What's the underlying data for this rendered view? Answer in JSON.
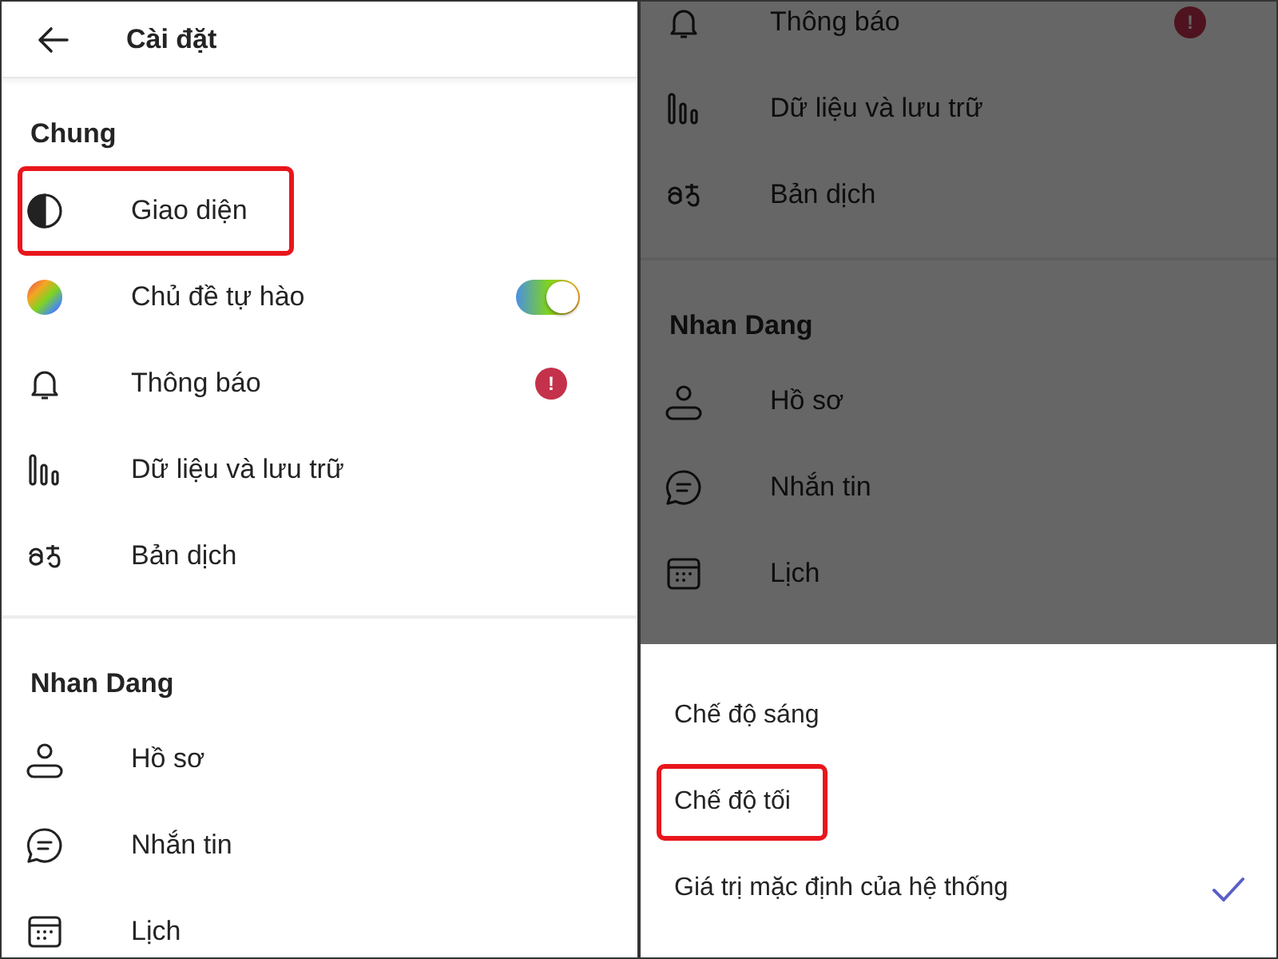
{
  "settings_page": {
    "header": {
      "title": "Cài đặt"
    },
    "sections": [
      {
        "title": "Chung",
        "items": [
          {
            "kind": "contrast",
            "label": "Giao diện",
            "highlighted": true
          },
          {
            "kind": "palette",
            "label": "Chủ đề tự hào",
            "highlighted": false,
            "toggle": {
              "on": true
            }
          },
          {
            "kind": "bell",
            "label": "Thông báo",
            "highlighted": false,
            "badge": "!"
          },
          {
            "kind": "bars",
            "label": "Dữ liệu và lưu trữ",
            "highlighted": false
          },
          {
            "kind": "translate",
            "label": "Bản dịch",
            "highlighted": false
          }
        ]
      },
      {
        "title": "Nhan Dang",
        "items": [
          {
            "kind": "person",
            "label": "Hồ sơ",
            "highlighted": false
          },
          {
            "kind": "chat",
            "label": "Nhắn tin",
            "highlighted": false
          },
          {
            "kind": "calendar",
            "label": "Lịch",
            "highlighted": false
          }
        ]
      }
    ]
  },
  "appearance_page": {
    "sections": [
      {
        "items": [
          {
            "kind": "bell",
            "label": "Thông báo",
            "highlighted": false,
            "badge": "!"
          },
          {
            "kind": "bars",
            "label": "Dữ liệu và lưu trữ",
            "highlighted": false
          },
          {
            "kind": "translate",
            "label": "Bản dịch",
            "highlighted": false
          }
        ]
      },
      {
        "title": "Nhan Dang",
        "items": [
          {
            "kind": "person",
            "label": "Hồ sơ",
            "highlighted": false
          },
          {
            "kind": "chat",
            "label": "Nhắn tin",
            "highlighted": false
          },
          {
            "kind": "calendar",
            "label": "Lịch",
            "highlighted": false
          }
        ]
      }
    ],
    "sheet": {
      "options": [
        {
          "label": "Chế độ sáng",
          "selected": false,
          "highlighted": false
        },
        {
          "label": "Chế độ tối",
          "selected": false,
          "highlighted": true
        },
        {
          "label": "Giá trị mặc định của hệ thống",
          "selected": true,
          "highlighted": false
        }
      ]
    }
  }
}
